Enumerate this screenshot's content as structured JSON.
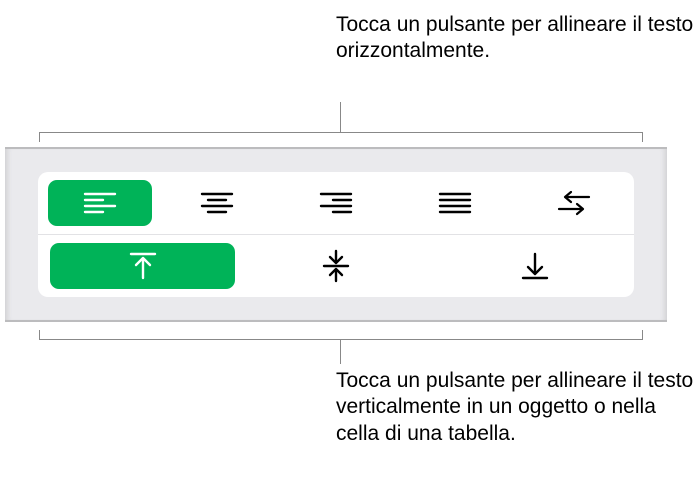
{
  "callouts": {
    "top": "Tocca un pulsante per allineare il testo orizzontalmente.",
    "bottom": "Tocca un pulsante per allineare il testo verticalmente in un oggetto o nella cella di una tabella."
  },
  "alignment": {
    "horizontal": {
      "selected": 0,
      "items": [
        "align-left",
        "align-center",
        "align-right",
        "align-justify",
        "text-direction"
      ]
    },
    "vertical": {
      "selected": 0,
      "items": [
        "align-top",
        "align-middle",
        "align-bottom"
      ]
    }
  }
}
